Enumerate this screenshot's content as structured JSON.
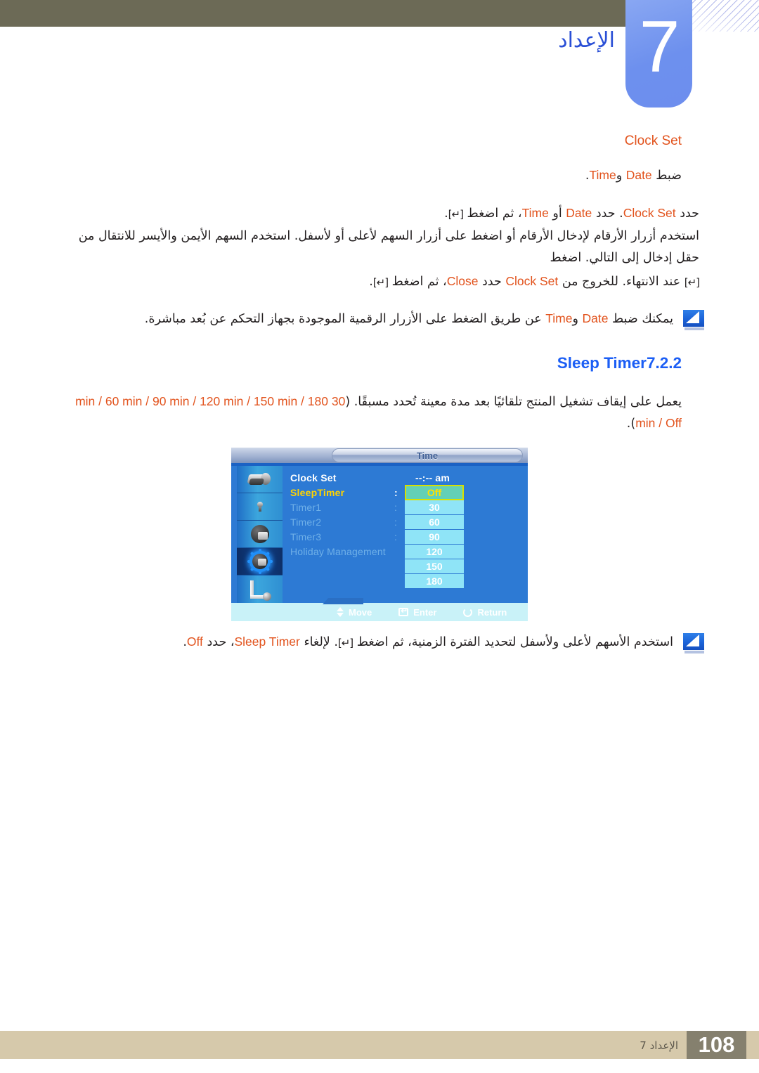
{
  "header": {
    "chapter_number": "7",
    "chapter_title": "الإعداد"
  },
  "topic": {
    "title": "Clock Set",
    "subtitle_prefix": "ضبط ",
    "subtitle_date": "Date",
    "subtitle_mid": " و",
    "subtitle_time": "Time",
    "subtitle_suffix": ".",
    "paragraph1": {
      "a": "حدد ",
      "clockset": "Clock Set",
      "b": ". حدد ",
      "date": "Date",
      "c": " أو ",
      "time": "Time",
      "d": "، ثم اضغط ",
      "key": "[↵]",
      "e": "."
    },
    "paragraph2": "استخدم أزرار الأرقام لإدخال الأرقام أو اضغط على أزرار السهم لأعلى أو لأسفل. استخدم السهم الأيمن والأيسر للانتقال من حقل إدخال إلى التالي. اضغط",
    "paragraph3": {
      "key": "[↵]",
      "a": " عند الانتهاء. للخروج من ",
      "clockset": "Clock Set",
      "b": " حدد ",
      "close": "Close",
      "c": "، ثم اضغط ",
      "key2": "[↵]",
      "d": "."
    },
    "note1": {
      "a": "يمكنك ضبط ",
      "date": "Date",
      "b": " و",
      "time": "Time",
      "c": " عن طريق الضغط على الأزرار الرقمية الموجودة بجهاز التحكم عن بُعد مباشرة."
    }
  },
  "section": {
    "number": "7.2.2",
    "name": "Sleep Timer",
    "options_line": {
      "a": "يعمل على إيقاف تشغيل المنتج تلقائيًا بعد مدة معينة تُحدد مسبقًا. (",
      "opts": "30 min / 60 min / 90 min / 120 min / 150 min / 180 min / Off",
      "b": ")."
    },
    "note2": {
      "a": "استخدم الأسهم لأعلى ولأسفل لتحديد الفترة الزمنية، ثم اضغط ",
      "key": "[↵]",
      "b": ". لإلغاء ",
      "sleeptimer": "Sleep Timer",
      "c": "، حدد ",
      "off": "Off",
      "d": "."
    }
  },
  "osd": {
    "title": "Time",
    "sidebar_icons": [
      "picture-tube-icon",
      "sound-icon",
      "knob-icon",
      "gear-icon",
      "connector-icon"
    ],
    "rows": [
      {
        "label": "Clock Set",
        "colon": "",
        "value": "--:-- am",
        "state": "normal"
      },
      {
        "label": "SleepTimer",
        "colon": ":",
        "value": "",
        "state": "selected"
      },
      {
        "label": "Timer1",
        "colon": ":",
        "value": "",
        "state": "dim"
      },
      {
        "label": "Timer2",
        "colon": ":",
        "value": "",
        "state": "dim"
      },
      {
        "label": "Timer3",
        "colon": ":",
        "value": "",
        "state": "dim"
      },
      {
        "label": "Holiday Management",
        "colon": "",
        "value": "",
        "state": "dim"
      }
    ],
    "dropdown": {
      "selected": "Off",
      "options": [
        "Off",
        "30",
        "60",
        "90",
        "120",
        "150",
        "180"
      ]
    },
    "legend": [
      {
        "icon": "move-icon",
        "label": "Move"
      },
      {
        "icon": "enter-icon",
        "label": "Enter"
      },
      {
        "icon": "return-icon",
        "label": "Return"
      }
    ]
  },
  "footer": {
    "text": "الإعداد 7",
    "page": "108"
  },
  "colors": {
    "header_olive": "#6c6a56",
    "chapter_blue": "#6d90ee",
    "accent_orange": "#e2531d",
    "heading_blue": "#1b5ef5",
    "osd_blue": "#2d7ad4",
    "footer_tan": "#d6c9ab",
    "page_box": "#85806e"
  }
}
